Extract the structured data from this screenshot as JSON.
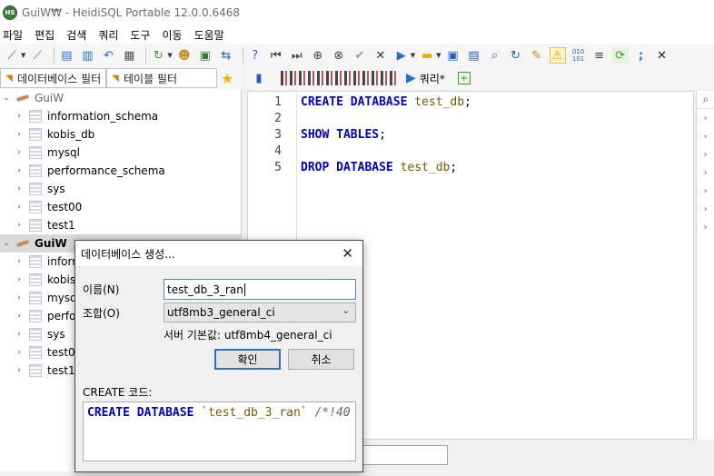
{
  "window": {
    "title": "GuiW₩ - HeidiSQL Portable 12.0.0.6468",
    "logo_text": "HS"
  },
  "menu": [
    "파일",
    "편집",
    "검색",
    "쿼리",
    "도구",
    "이동",
    "도움말"
  ],
  "toolbar": {
    "icons": [
      "connect-icon",
      "disconnect-icon",
      "copy-icon",
      "paste-icon",
      "undo-icon",
      "print-icon",
      "refresh-icon",
      "user-manager-icon",
      "export-icon",
      "transfer-icon",
      "help-icon",
      "first-icon",
      "last-icon",
      "add-icon",
      "delete-icon",
      "apply-icon",
      "cancel-icon",
      "run-icon",
      "open-icon",
      "save-icon",
      "save-as-icon",
      "find-icon",
      "find-replace-icon",
      "clear-icon",
      "warning-icon",
      "binary-icon",
      "wrap-icon",
      "format-icon",
      "separator-icon",
      "close-icon"
    ],
    "binary_text": "010\n101"
  },
  "filters": {
    "database": "데이터베이스 필터",
    "table": "테이블 필터"
  },
  "tabs": {
    "query": "쿼리*"
  },
  "tree": {
    "session1": {
      "name": "GuiW",
      "databases": [
        "information_schema",
        "kobis_db",
        "mysql",
        "performance_schema",
        "sys",
        "test00",
        "test1"
      ]
    },
    "session2": {
      "name": "GuiW",
      "databases": [
        "inform",
        "kobis_",
        "mysql",
        "perfor",
        "sys",
        "test00",
        "test1"
      ]
    }
  },
  "editor": {
    "line_numbers": [
      "1",
      "2",
      "3",
      "4",
      "5"
    ],
    "lines": [
      {
        "kw": "CREATE DATABASE",
        "id": "test_db",
        "end": ";"
      },
      {
        "kw": "",
        "id": "",
        "end": ""
      },
      {
        "kw": "SHOW TABLES",
        "id": "",
        "end": ";"
      },
      {
        "kw": "",
        "id": "",
        "end": ""
      },
      {
        "kw": "DROP DATABASE",
        "id": "test_db",
        "end": ";"
      }
    ]
  },
  "dialog": {
    "title": "데이터베이스 생성...",
    "name_label": "이름(N)",
    "name_value": "test_db_3_ran",
    "collation_label": "조합(O)",
    "collation_value": "utf8mb3_general_ci",
    "server_default": "서버 기본값: utf8mb4_general_ci",
    "ok_label": "확인",
    "cancel_label": "취소",
    "code_label": "CREATE 코드:",
    "code_kw": "CREATE DATABASE",
    "code_id": " `test_db_3_ran`",
    "code_comment": " /*!40"
  },
  "colors": {
    "keyword": "#0000c8",
    "identifier": "#7a5a00",
    "accent": "#2f72c4"
  }
}
